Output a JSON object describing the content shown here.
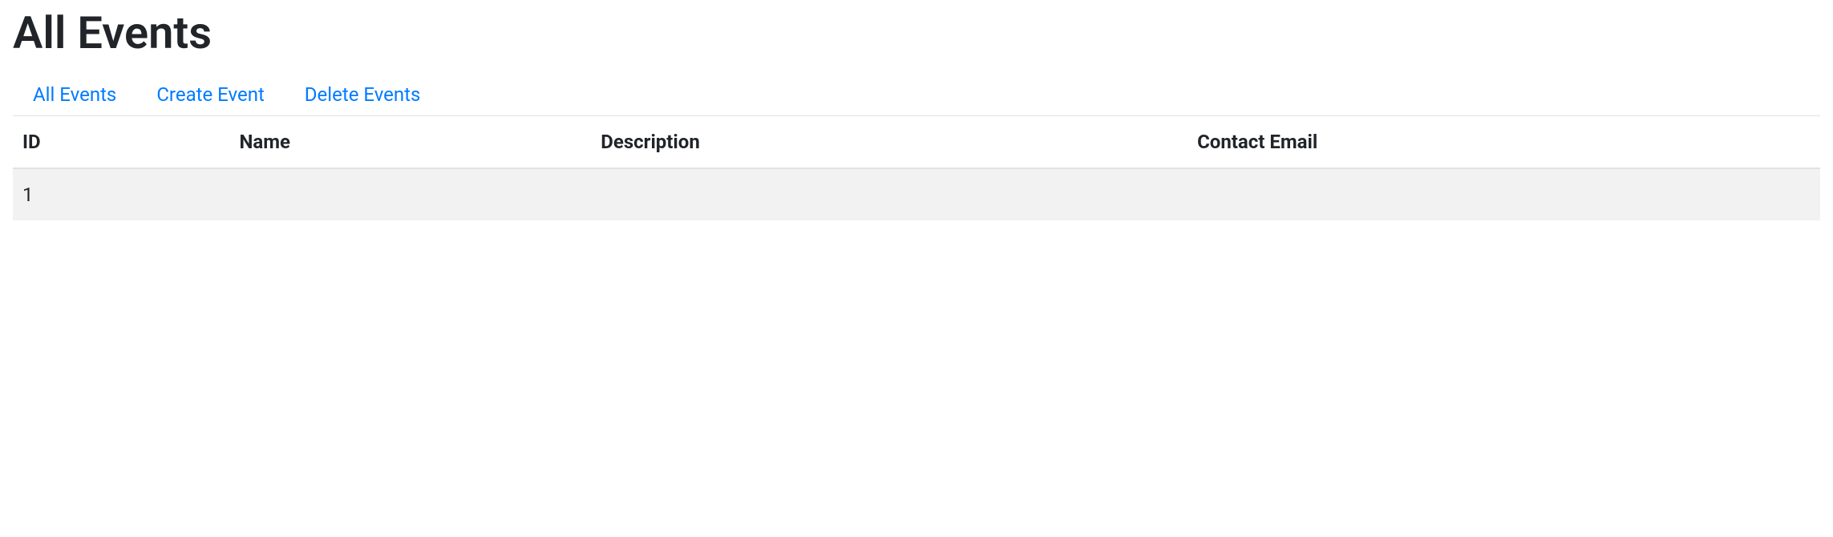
{
  "page": {
    "title": "All Events"
  },
  "nav": {
    "tabs": [
      {
        "label": "All Events"
      },
      {
        "label": "Create Event"
      },
      {
        "label": "Delete Events"
      }
    ]
  },
  "table": {
    "headers": {
      "id": "ID",
      "name": "Name",
      "description": "Description",
      "contact_email": "Contact Email"
    },
    "rows": [
      {
        "id": "1",
        "name": "",
        "description": "",
        "contact_email": ""
      }
    ]
  }
}
